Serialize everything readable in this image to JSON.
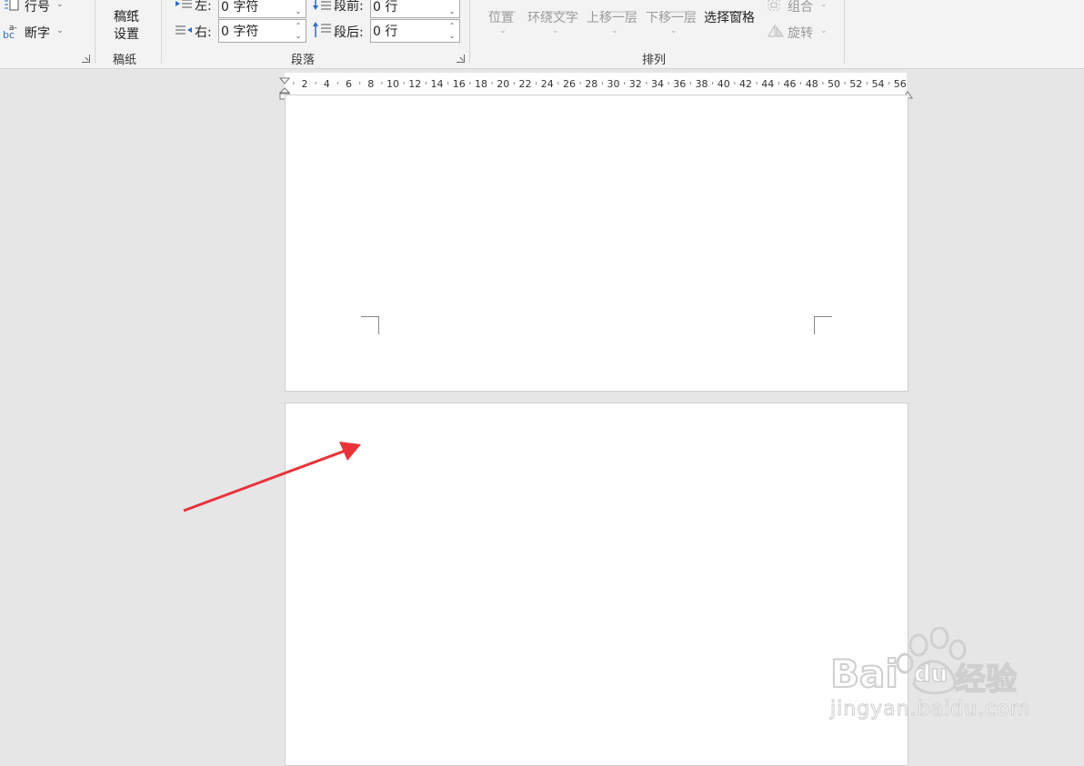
{
  "ribbon": {
    "line_numbers_label": "行号",
    "hyphenation_label": "断字",
    "manuscript_settings_line1": "稿纸",
    "manuscript_settings_line2": "设置",
    "group_manuscript": "稿纸",
    "group_paragraph": "段落",
    "group_arrange": "排列",
    "indent_left_label": "左:",
    "indent_left_value": "0 字符",
    "indent_right_label": "右:",
    "indent_right_value": "0 字符",
    "space_before_label": "段前:",
    "space_before_value": "0 行",
    "space_after_label": "段后:",
    "space_after_value": "0 行",
    "position_label": "位置",
    "wrap_text_label": "环绕文字",
    "bring_forward_label": "上移一层",
    "send_backward_label": "下移一层",
    "selection_pane_label": "选择窗格",
    "group_label": "组合",
    "rotate_label": "旋转"
  },
  "ruler": {
    "ticks": [
      "2",
      "4",
      "6",
      "8",
      "10",
      "12",
      "14",
      "16",
      "18",
      "20",
      "22",
      "24",
      "26",
      "28",
      "30",
      "32",
      "34",
      "36",
      "38",
      "40",
      "42",
      "44",
      "46",
      "48",
      "50",
      "52",
      "54",
      "56"
    ]
  },
  "watermark": {
    "brand": "Bai",
    "brand_du": "du",
    "brand_cn": "经验",
    "url": "jingyan.baidu.com"
  },
  "colors": {
    "arrow": "#e8333a",
    "ribbon_bg": "#f3f3f3",
    "workspace_bg": "#e6e6e6",
    "indent_icon_blue": "#2f6cc4"
  }
}
